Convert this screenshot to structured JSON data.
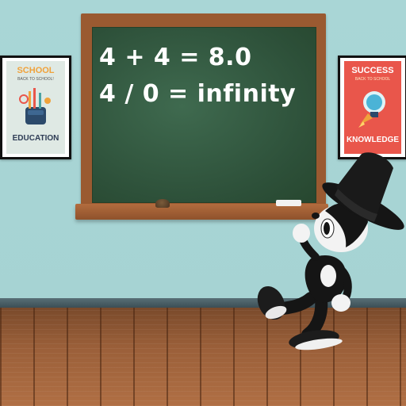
{
  "scene": {
    "blackboard": {
      "equation_1": "4 + 4 = 8.0",
      "equation_2": "4 / 0 = infinity"
    },
    "poster_left": {
      "title": "SCHOOL",
      "subtitle": "BACK TO SCHOOL!",
      "bottom": "EDUCATION",
      "icon": "school-supplies-icon"
    },
    "poster_right": {
      "title": "SUCCESS",
      "subtitle": "BACK TO SCHOOL",
      "bottom": "KNOWLEDGE",
      "icon": "lightbulb-rocket-icon"
    },
    "character": "cartoon-character-top-hat"
  },
  "colors": {
    "wall": "#a9d6d6",
    "board": "#2f5640",
    "frame": "#9a5a31",
    "floor": "#9a5f39",
    "poster_right_bg": "#e9564b"
  }
}
